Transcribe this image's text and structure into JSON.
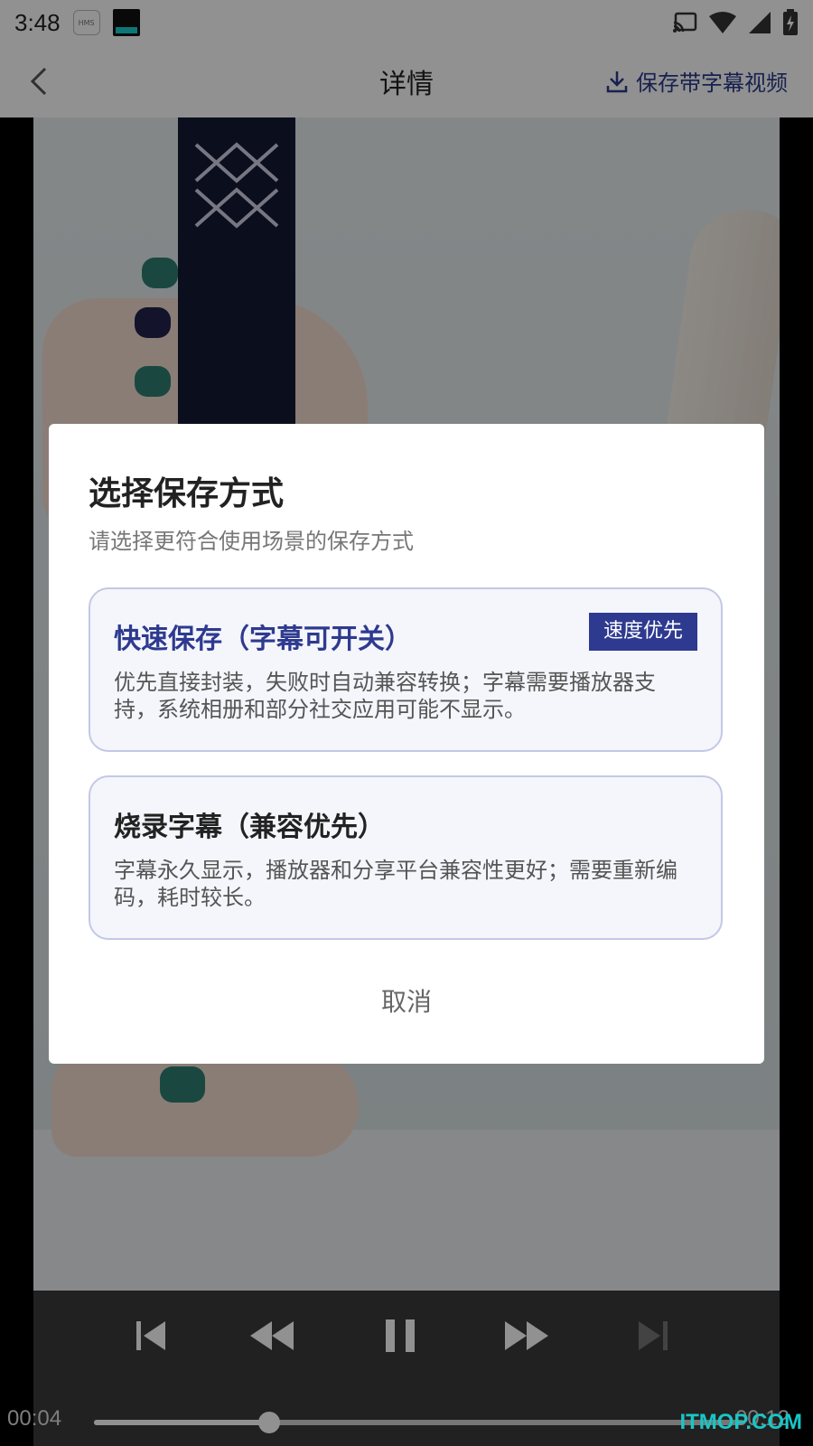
{
  "status_bar": {
    "time": "3:48",
    "hms_label": "HMS"
  },
  "top_bar": {
    "title": "详情",
    "save_action_label": "保存带字幕视频"
  },
  "player": {
    "current_time": "00:04",
    "total_time": "00:12",
    "progress": 0.27
  },
  "dialog": {
    "title": "选择保存方式",
    "subtitle": "请选择更符合使用场景的保存方式",
    "options": [
      {
        "title": "快速保存（字幕可开关）",
        "badge": "速度优先",
        "description": "优先直接封装，失败时自动兼容转换；字幕需要播放器支持，系统相册和部分社交应用可能不显示。"
      },
      {
        "title": "烧录字幕（兼容优先）",
        "description": "字幕永久显示，播放器和分享平台兼容性更好；需要重新编码，耗时较长。"
      }
    ],
    "cancel_label": "取消"
  },
  "watermark": "ITMOP.COM",
  "colors": {
    "accent": "#2e3a8f",
    "option_border": "#c3c8e6",
    "option_background": "#f4f6fb"
  }
}
